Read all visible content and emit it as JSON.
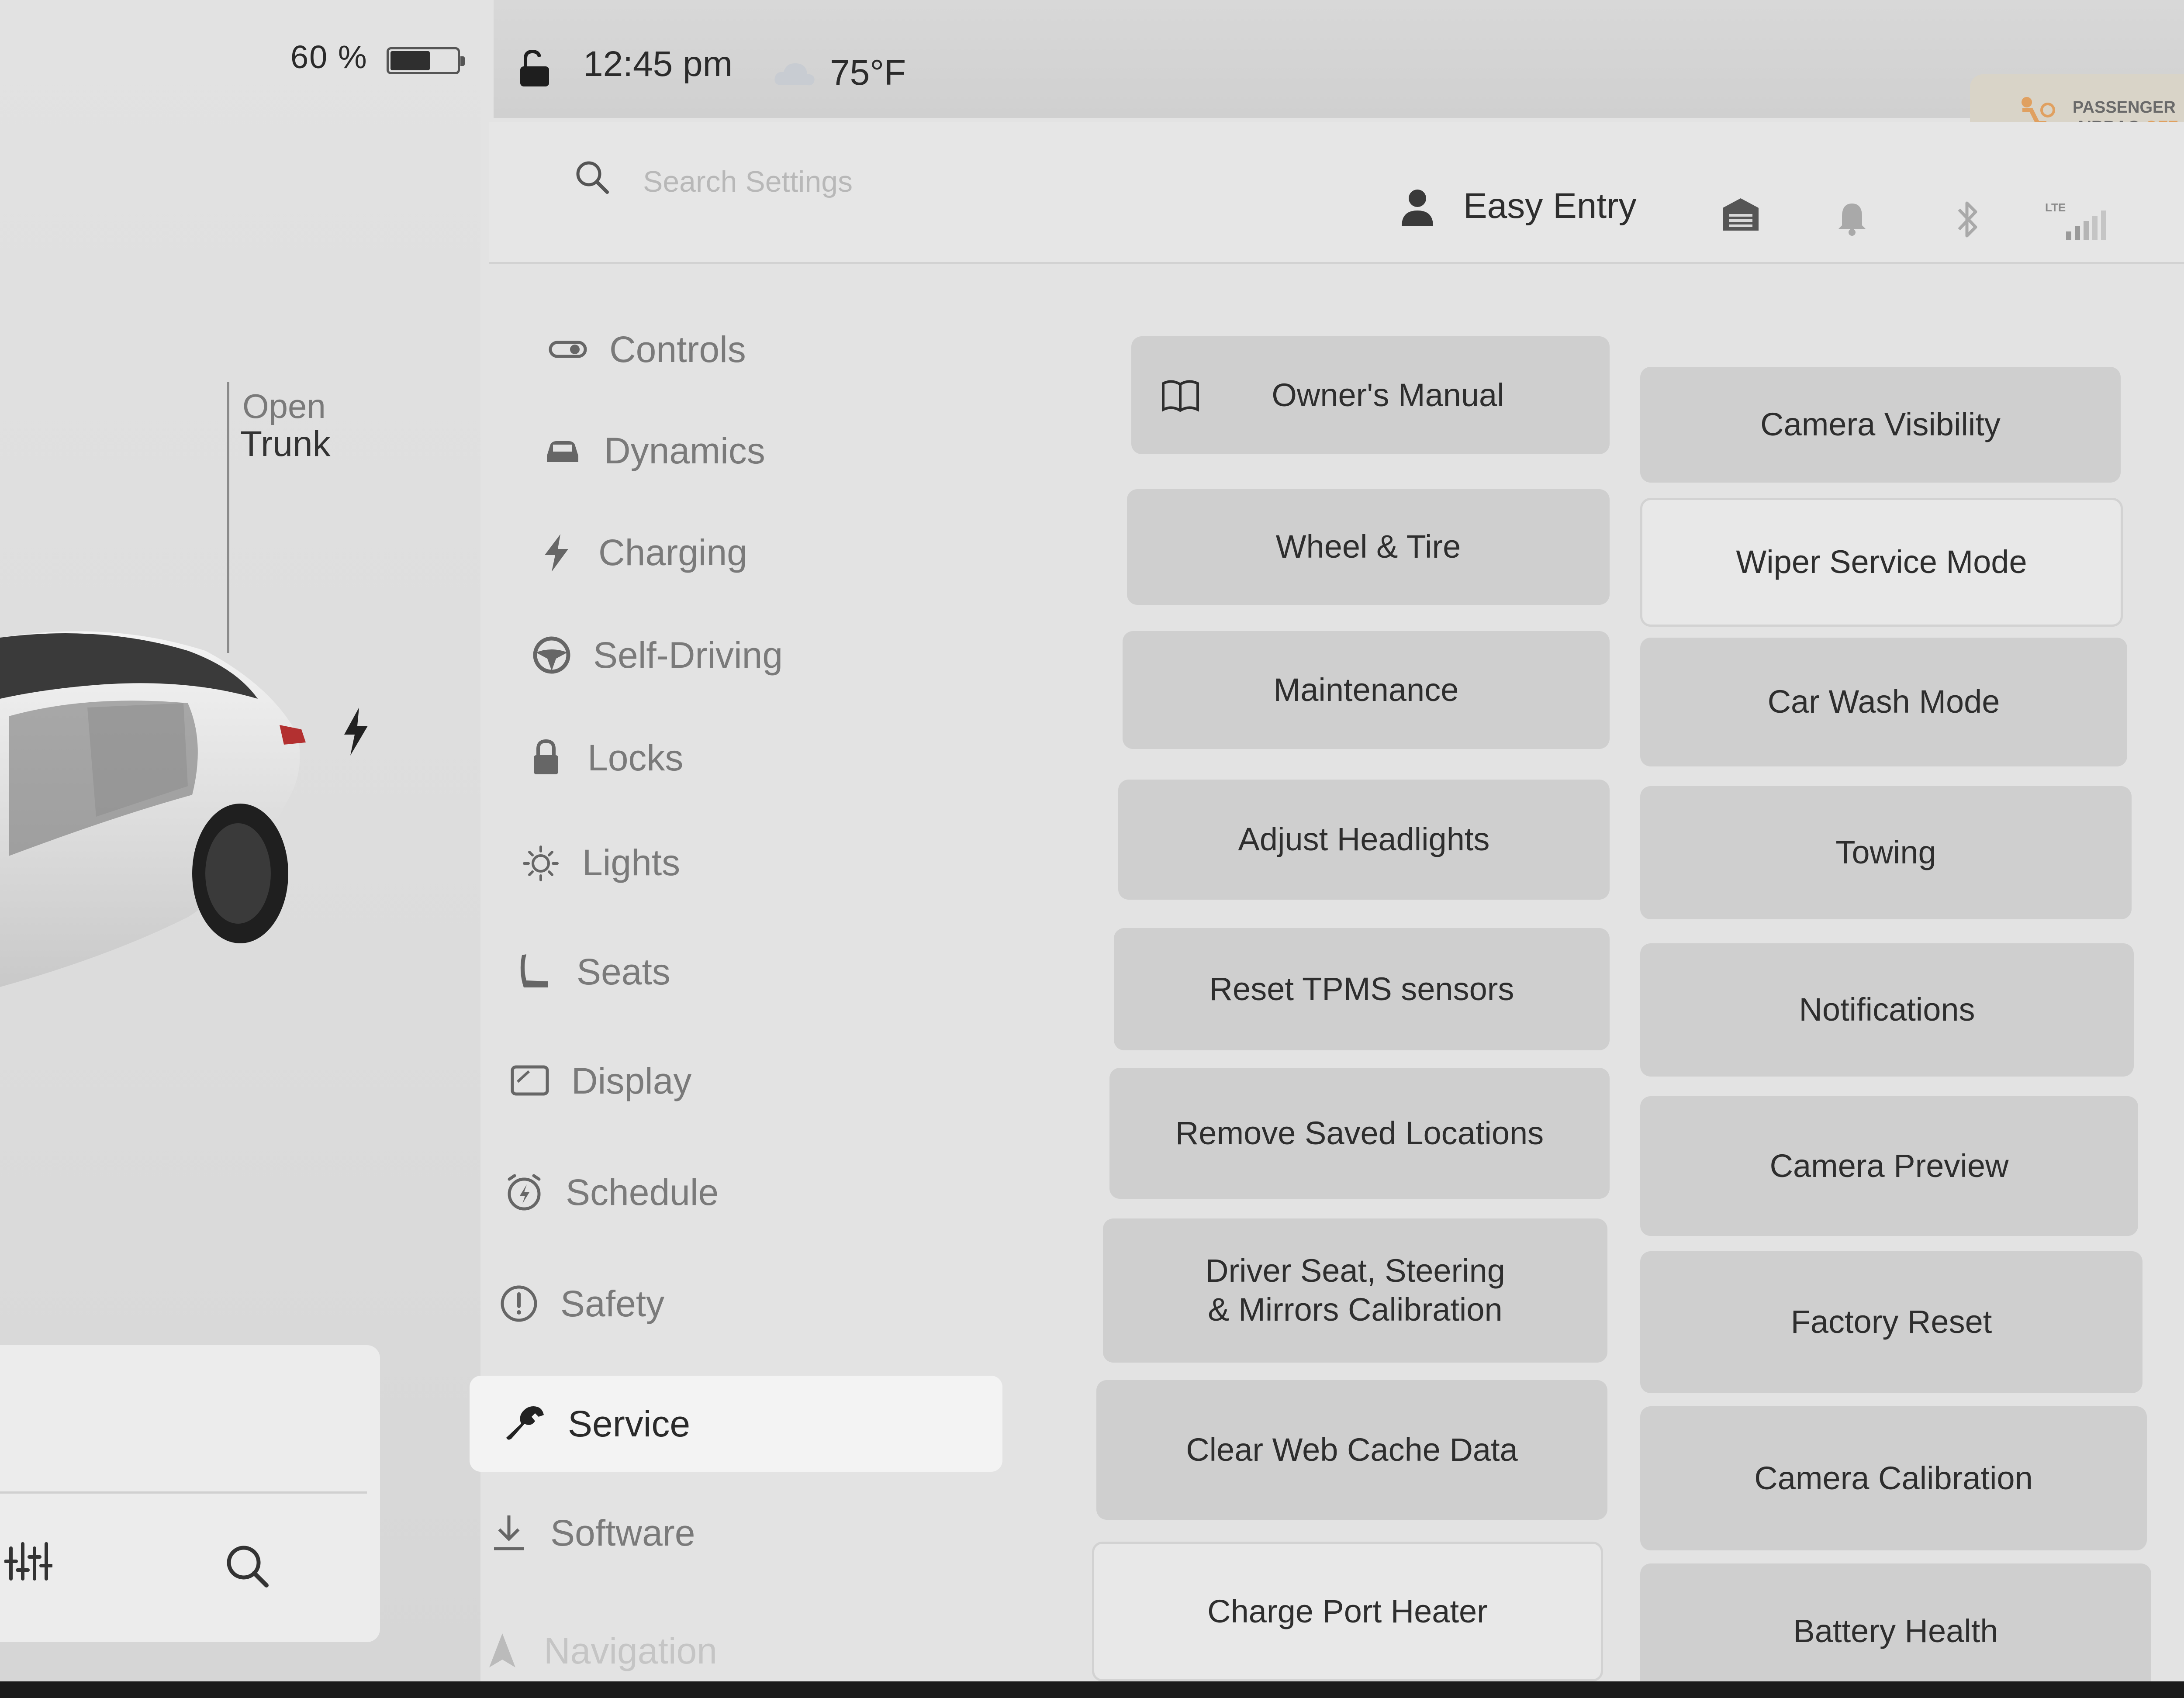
{
  "status_bar": {
    "battery_percent": "60 %",
    "battery_level": 0.6,
    "time": "12:45 pm",
    "temperature": "75°F",
    "airbag_line1": "PASSENGER",
    "airbag_line2": "AIRBAG",
    "airbag_state": "OFF"
  },
  "car_panel": {
    "trunk_action": "Open",
    "trunk_label": "Trunk"
  },
  "header": {
    "search_placeholder": "Search Settings",
    "profile_name": "Easy Entry",
    "network_label": "LTE"
  },
  "nav": {
    "items": [
      {
        "label": "Controls",
        "icon": "toggle-icon"
      },
      {
        "label": "Dynamics",
        "icon": "car-icon"
      },
      {
        "label": "Charging",
        "icon": "bolt-icon"
      },
      {
        "label": "Self-Driving",
        "icon": "steering-wheel-icon"
      },
      {
        "label": "Locks",
        "icon": "lock-icon"
      },
      {
        "label": "Lights",
        "icon": "light-icon"
      },
      {
        "label": "Seats",
        "icon": "seat-icon"
      },
      {
        "label": "Display",
        "icon": "display-icon"
      },
      {
        "label": "Schedule",
        "icon": "schedule-icon"
      },
      {
        "label": "Safety",
        "icon": "alert-icon"
      },
      {
        "label": "Service",
        "icon": "wrench-icon",
        "active": true
      },
      {
        "label": "Software",
        "icon": "download-icon"
      },
      {
        "label": "Navigation",
        "icon": "navigation-icon"
      }
    ]
  },
  "service": {
    "left_column": [
      "Owner's Manual",
      "Wheel & Tire",
      "Maintenance",
      "Adjust Headlights",
      "Reset TPMS sensors",
      "Remove Saved Locations",
      "Driver Seat, Steering\n& Mirrors Calibration",
      "Clear Web Cache Data",
      "Charge Port Heater"
    ],
    "right_column": [
      "Camera Visibility",
      "Wiper Service Mode",
      "Car Wash Mode",
      "Towing",
      "Notifications",
      "Camera Preview",
      "Factory Reset",
      "Camera Calibration",
      "Battery Health"
    ]
  },
  "colors": {
    "screen_bg": "#e3e3e3",
    "tile_bg": "#cfcfcf",
    "active_nav_bg": "#f3f3f3",
    "text_dark": "#2e2e2e",
    "text_muted": "#7a7a7a"
  }
}
